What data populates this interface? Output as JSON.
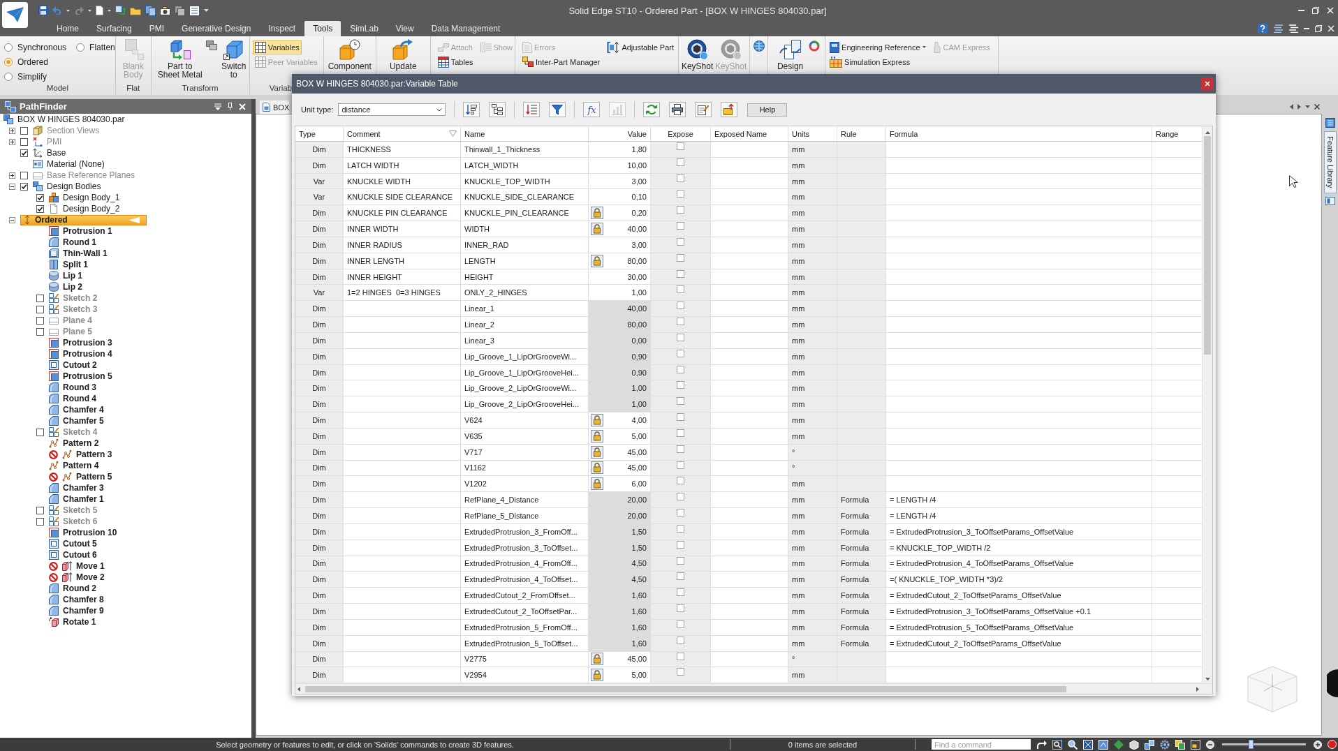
{
  "window": {
    "title": "Solid Edge ST10 - Ordered Part - [BOX W HINGES 804030.par]"
  },
  "ribbon": {
    "tabs": [
      {
        "label": "Home",
        "selected": false
      },
      {
        "label": "Surfacing",
        "selected": false
      },
      {
        "label": "PMI",
        "selected": false
      },
      {
        "label": "Generative Design",
        "selected": false
      },
      {
        "label": "Inspect",
        "selected": false
      },
      {
        "label": "Tools",
        "selected": true
      },
      {
        "label": "SimLab",
        "selected": false
      },
      {
        "label": "View",
        "selected": false
      },
      {
        "label": "Data Management",
        "selected": false
      }
    ],
    "groups": [
      {
        "label": "Model",
        "items": [
          {
            "kind": "radio",
            "label": "Synchronous",
            "selected": false
          },
          {
            "kind": "radio",
            "label": "Flatten",
            "selected": false
          },
          {
            "kind": "radio",
            "label": "Ordered",
            "selected": true
          },
          {
            "kind": "radio",
            "label": "Simplify",
            "selected": false
          }
        ]
      },
      {
        "label": "Flat",
        "items": [
          {
            "kind": "large",
            "label": "Blank Body",
            "disabled": true
          }
        ]
      },
      {
        "label": "Transform",
        "items": [
          {
            "kind": "large",
            "label": "Part to Sheet Metal",
            "disabled": false
          },
          {
            "kind": "icon",
            "disabled": false
          },
          {
            "kind": "large",
            "label": "Switch to",
            "disabled": false
          }
        ]
      },
      {
        "label": "Variab",
        "items": [
          {
            "kind": "small",
            "label": "Variables",
            "disabled": false,
            "on": true
          },
          {
            "kind": "small",
            "label": "Peer Variables",
            "disabled": true,
            "on": false
          }
        ]
      },
      {
        "items": [
          {
            "kind": "large",
            "label": "Component",
            "disabled": false
          }
        ]
      },
      {
        "items": [
          {
            "kind": "large",
            "label": "Update",
            "disabled": false
          }
        ]
      },
      {
        "items": [
          {
            "kind": "small",
            "label": "Attach",
            "disabled": true
          },
          {
            "kind": "small",
            "label": "Show",
            "disabled": true
          },
          {
            "kind": "small",
            "label": "Tables",
            "disabled": false
          }
        ]
      },
      {
        "items": [
          {
            "kind": "small",
            "label": "Errors",
            "disabled": true
          },
          {
            "kind": "small",
            "label": "Adjustable Part",
            "disabled": false
          },
          {
            "kind": "small",
            "label": "Inter-Part Manager",
            "disabled": false
          }
        ]
      },
      {
        "items": [
          {
            "kind": "large",
            "label": "KeyShot",
            "disabled": false
          },
          {
            "kind": "large",
            "label": "KeyShot",
            "disabled": true
          }
        ]
      },
      {
        "items": [
          {
            "kind": "icon",
            "disabled": false
          }
        ]
      },
      {
        "items": [
          {
            "kind": "large",
            "label": "Design",
            "disabled": false
          },
          {
            "kind": "icon",
            "disabled": false
          }
        ]
      },
      {
        "items": [
          {
            "kind": "small",
            "label": "Engineering Reference",
            "disabled": false,
            "dropdown": true
          },
          {
            "kind": "small",
            "label": "CAM Express",
            "disabled": true,
            "dropdown": false
          },
          {
            "kind": "small",
            "label": "Simulation Express",
            "disabled": false,
            "dropdown": false
          }
        ]
      }
    ]
  },
  "pathfinder": {
    "title": "PathFinder",
    "tree": [
      {
        "label": "BOX W HINGES 804030.par",
        "kind": "part",
        "selected": false,
        "children": [
          {
            "label": "Section Views",
            "kind": "section-views",
            "expanded": false,
            "checked": false,
            "selected": false
          },
          {
            "label": "PMI",
            "kind": "pmi",
            "expanded": false,
            "checked": false,
            "selected": false
          },
          {
            "label": "Base",
            "kind": "base",
            "checked": true,
            "selected": false
          },
          {
            "label": "Material (None)",
            "kind": "material",
            "selected": false
          },
          {
            "label": "Base Reference Planes",
            "kind": "reference-planes",
            "expanded": false,
            "checked": false,
            "selected": false
          },
          {
            "label": "Design Bodies",
            "kind": "design-bodies",
            "expanded": true,
            "checked": true,
            "selected": false,
            "children": [
              {
                "label": "Design Body_1",
                "kind": "body",
                "checked": true,
                "selected": false
              },
              {
                "label": "Design Body_2",
                "kind": "empty-body",
                "checked": true,
                "selected": false
              }
            ]
          },
          {
            "label": "Ordered",
            "kind": "ordered",
            "expanded": true,
            "selected": true,
            "children": [
              {
                "label": "Protrusion 1",
                "kind": "protrusion",
                "selected": false,
                "suppressed": false
              },
              {
                "label": "Round 1",
                "kind": "round",
                "selected": false,
                "suppressed": false
              },
              {
                "label": "Thin-Wall 1",
                "kind": "thin-wall",
                "selected": false,
                "suppressed": false
              },
              {
                "label": "Split 1",
                "kind": "split",
                "selected": false,
                "suppressed": false
              },
              {
                "label": "Lip 1",
                "kind": "lip",
                "selected": false,
                "suppressed": false
              },
              {
                "label": "Lip 2",
                "kind": "lip",
                "selected": false,
                "suppressed": false
              },
              {
                "label": "Sketch 2",
                "kind": "sketch",
                "checked": false,
                "selected": false,
                "suppressed": false
              },
              {
                "label": "Sketch 3",
                "kind": "sketch",
                "checked": false,
                "selected": false,
                "suppressed": false
              },
              {
                "label": "Plane 4",
                "kind": "plane",
                "checked": false,
                "selected": false,
                "suppressed": false
              },
              {
                "label": "Plane 5",
                "kind": "plane",
                "checked": false,
                "selected": false,
                "suppressed": false
              },
              {
                "label": "Protrusion 3",
                "kind": "protrusion",
                "selected": false,
                "suppressed": false
              },
              {
                "label": "Protrusion 4",
                "kind": "protrusion",
                "selected": false,
                "suppressed": false
              },
              {
                "label": "Cutout 2",
                "kind": "cutout",
                "selected": false,
                "suppressed": false
              },
              {
                "label": "Protrusion 5",
                "kind": "protrusion",
                "selected": false,
                "suppressed": false
              },
              {
                "label": "Round 3",
                "kind": "round",
                "selected": false,
                "suppressed": false
              },
              {
                "label": "Round 4",
                "kind": "round",
                "selected": false,
                "suppressed": false
              },
              {
                "label": "Chamfer 4",
                "kind": "chamfer",
                "selected": false,
                "suppressed": false
              },
              {
                "label": "Chamfer 5",
                "kind": "chamfer",
                "selected": false,
                "suppressed": false
              },
              {
                "label": "Sketch 4",
                "kind": "sketch",
                "checked": false,
                "selected": false,
                "suppressed": false
              },
              {
                "label": "Pattern 2",
                "kind": "pattern",
                "selected": false,
                "suppressed": false
              },
              {
                "label": "Pattern 3",
                "kind": "pattern",
                "selected": false,
                "suppressed": true
              },
              {
                "label": "Pattern 4",
                "kind": "pattern",
                "selected": false,
                "suppressed": false
              },
              {
                "label": "Pattern 5",
                "kind": "pattern",
                "selected": false,
                "suppressed": true
              },
              {
                "label": "Chamfer 3",
                "kind": "chamfer",
                "selected": false,
                "suppressed": false
              },
              {
                "label": "Chamfer 1",
                "kind": "chamfer",
                "selected": false,
                "suppressed": false
              },
              {
                "label": "Sketch 5",
                "kind": "sketch",
                "checked": false,
                "selected": false,
                "suppressed": false
              },
              {
                "label": "Sketch 6",
                "kind": "sketch",
                "checked": false,
                "selected": false,
                "suppressed": false
              },
              {
                "label": "Protrusion 10",
                "kind": "protrusion",
                "selected": false,
                "suppressed": false
              },
              {
                "label": "Cutout 5",
                "kind": "cutout",
                "selected": false,
                "suppressed": false
              },
              {
                "label": "Cutout 6",
                "kind": "cutout",
                "selected": false,
                "suppressed": false
              },
              {
                "label": "Move 1",
                "kind": "move",
                "selected": false,
                "suppressed": true
              },
              {
                "label": "Move 2",
                "kind": "move",
                "selected": false,
                "suppressed": true
              },
              {
                "label": "Round 2",
                "kind": "round",
                "selected": false,
                "suppressed": false
              },
              {
                "label": "Chamfer 8",
                "kind": "chamfer",
                "selected": false,
                "suppressed": false
              },
              {
                "label": "Chamfer 9",
                "kind": "chamfer",
                "selected": false,
                "suppressed": false
              },
              {
                "label": "Rotate 1",
                "kind": "rotate",
                "selected": false,
                "suppressed": false
              }
            ]
          }
        ]
      }
    ]
  },
  "document": {
    "tab": "BOX",
    "side_tab": "Feature Library"
  },
  "variable_table": {
    "title": "BOX W HINGES 804030.par:Variable Table",
    "unit_type_label": "Unit type:",
    "unit_type": "distance",
    "toolbar": [
      {
        "disabled": false
      },
      {
        "disabled": false
      },
      {
        "disabled": false
      },
      {
        "disabled": false
      },
      {
        "label": "fx",
        "disabled": false
      },
      {
        "disabled": true
      },
      {
        "disabled": false
      },
      {
        "disabled": false
      },
      {
        "disabled": false
      },
      {
        "disabled": false
      }
    ],
    "help_button": "Help",
    "columns": [
      "Type",
      "Comment",
      "Name",
      "Value",
      "Expose",
      "Exposed Name",
      "Units",
      "Rule",
      "Formula",
      "Range"
    ],
    "rows": [
      {
        "type": "Dim",
        "comment": "THICKNESS",
        "name": "Thinwall_1_Thickness",
        "locked": false,
        "value": "1,80",
        "read_only": false,
        "expose": false,
        "units": "mm"
      },
      {
        "type": "Dim",
        "comment": "LATCH WIDTH",
        "name": "LATCH_WIDTH",
        "locked": false,
        "value": "10,00",
        "read_only": false,
        "expose": false,
        "units": "mm"
      },
      {
        "type": "Var",
        "comment": "KNUCKLE WIDTH",
        "name": "KNUCKLE_TOP_WIDTH",
        "locked": false,
        "value": "3,00",
        "read_only": false,
        "expose": false,
        "units": "mm"
      },
      {
        "type": "Var",
        "comment": "KNUCKLE SIDE CLEARANCE",
        "name": "KNUCKLE_SIDE_CLEARANCE",
        "locked": false,
        "value": "0,10",
        "read_only": false,
        "expose": false,
        "units": "mm"
      },
      {
        "type": "Dim",
        "comment": "KNUCKLE PIN CLEARANCE",
        "name": "KNUCKLE_PIN_CLEARANCE",
        "locked": true,
        "value": "0,20",
        "read_only": false,
        "expose": false,
        "units": "mm"
      },
      {
        "type": "Dim",
        "comment": "INNER WIDTH",
        "name": "WIDTH",
        "locked": true,
        "value": "40,00",
        "read_only": false,
        "expose": false,
        "units": "mm"
      },
      {
        "type": "Dim",
        "comment": "INNER RADIUS",
        "name": "INNER_RAD",
        "locked": false,
        "value": "3,00",
        "read_only": false,
        "expose": false,
        "units": "mm"
      },
      {
        "type": "Dim",
        "comment": "INNER LENGTH",
        "name": "LENGTH",
        "locked": true,
        "value": "80,00",
        "read_only": false,
        "expose": false,
        "units": "mm"
      },
      {
        "type": "Dim",
        "comment": "INNER HEIGHT",
        "name": "HEIGHT",
        "locked": false,
        "value": "30,00",
        "read_only": false,
        "expose": false,
        "units": "mm"
      },
      {
        "type": "Var",
        "comment": "1=2 HINGES  0=3 HINGES",
        "name": "ONLY_2_HINGES",
        "locked": false,
        "value": "1,00",
        "read_only": false,
        "expose": false,
        "units": "mm"
      },
      {
        "type": "Dim",
        "name": "Linear_1",
        "locked": false,
        "value": "40,00",
        "read_only": true,
        "expose": false,
        "units": "mm"
      },
      {
        "type": "Dim",
        "name": "Linear_2",
        "locked": false,
        "value": "80,00",
        "read_only": true,
        "expose": false,
        "units": "mm"
      },
      {
        "type": "Dim",
        "name": "Linear_3",
        "locked": false,
        "value": "0,00",
        "read_only": true,
        "expose": false,
        "units": "mm"
      },
      {
        "type": "Dim",
        "name": "Lip_Groove_1_LipOrGrooveWi...",
        "locked": false,
        "value": "0,90",
        "read_only": true,
        "expose": false,
        "units": "mm"
      },
      {
        "type": "Dim",
        "name": "Lip_Groove_1_LipOrGrooveHei...",
        "locked": false,
        "value": "0,90",
        "read_only": true,
        "expose": false,
        "units": "mm"
      },
      {
        "type": "Dim",
        "name": "Lip_Groove_2_LipOrGrooveWi...",
        "locked": false,
        "value": "1,00",
        "read_only": true,
        "expose": false,
        "units": "mm"
      },
      {
        "type": "Dim",
        "name": "Lip_Groove_2_LipOrGrooveHei...",
        "locked": false,
        "value": "1,00",
        "read_only": true,
        "expose": false,
        "units": "mm"
      },
      {
        "type": "Dim",
        "name": "V624",
        "locked": true,
        "value": "4,00",
        "read_only": false,
        "expose": false,
        "units": "mm"
      },
      {
        "type": "Dim",
        "name": "V635",
        "locked": true,
        "value": "5,00",
        "read_only": false,
        "expose": false,
        "units": "mm"
      },
      {
        "type": "Dim",
        "name": "V717",
        "locked": true,
        "value": "45,00",
        "read_only": false,
        "expose": false,
        "units": "°"
      },
      {
        "type": "Dim",
        "name": "V1162",
        "locked": true,
        "value": "45,00",
        "read_only": false,
        "expose": false,
        "units": "°"
      },
      {
        "type": "Dim",
        "name": "V1202",
        "locked": true,
        "value": "6,00",
        "read_only": false,
        "expose": false,
        "units": "mm"
      },
      {
        "type": "Dim",
        "name": "RefPlane_4_Distance",
        "locked": false,
        "value": "20,00",
        "read_only": true,
        "expose": false,
        "units": "mm",
        "rule": "Formula",
        "formula": "= LENGTH /4"
      },
      {
        "type": "Dim",
        "name": "RefPlane_5_Distance",
        "locked": false,
        "value": "20,00",
        "read_only": true,
        "expose": false,
        "units": "mm",
        "rule": "Formula",
        "formula": "= LENGTH /4"
      },
      {
        "type": "Dim",
        "name": "ExtrudedProtrusion_3_FromOff...",
        "locked": false,
        "value": "1,50",
        "read_only": true,
        "expose": false,
        "units": "mm",
        "rule": "Formula",
        "formula": "= ExtrudedProtrusion_3_ToOffsetParams_OffsetValue"
      },
      {
        "type": "Dim",
        "name": "ExtrudedProtrusion_3_ToOffset...",
        "locked": false,
        "value": "1,50",
        "read_only": true,
        "expose": false,
        "units": "mm",
        "rule": "Formula",
        "formula": "= KNUCKLE_TOP_WIDTH /2"
      },
      {
        "type": "Dim",
        "name": "ExtrudedProtrusion_4_FromOff...",
        "locked": false,
        "value": "4,50",
        "read_only": true,
        "expose": false,
        "units": "mm",
        "rule": "Formula",
        "formula": "= ExtrudedProtrusion_4_ToOffsetParams_OffsetValue"
      },
      {
        "type": "Dim",
        "name": "ExtrudedProtrusion_4_ToOffset...",
        "locked": false,
        "value": "4,50",
        "read_only": true,
        "expose": false,
        "units": "mm",
        "rule": "Formula",
        "formula": "=( KNUCKLE_TOP_WIDTH *3)/2"
      },
      {
        "type": "Dim",
        "name": "ExtrudedCutout_2_FromOffset...",
        "locked": false,
        "value": "1,60",
        "read_only": true,
        "expose": false,
        "units": "mm",
        "rule": "Formula",
        "formula": "= ExtrudedCutout_2_ToOffsetParams_OffsetValue"
      },
      {
        "type": "Dim",
        "name": "ExtrudedCutout_2_ToOffsetPar...",
        "locked": false,
        "value": "1,60",
        "read_only": true,
        "expose": false,
        "units": "mm",
        "rule": "Formula",
        "formula": "= ExtrudedProtrusion_3_ToOffsetParams_OffsetValue +0.1"
      },
      {
        "type": "Dim",
        "name": "ExtrudedProtrusion_5_FromOff...",
        "locked": false,
        "value": "1,60",
        "read_only": true,
        "expose": false,
        "units": "mm",
        "rule": "Formula",
        "formula": "= ExtrudedProtrusion_5_ToOffsetParams_OffsetValue"
      },
      {
        "type": "Dim",
        "name": "ExtrudedProtrusion_5_ToOffset...",
        "locked": false,
        "value": "1,60",
        "read_only": true,
        "expose": false,
        "units": "mm",
        "rule": "Formula",
        "formula": "= ExtrudedCutout_2_ToOffsetParams_OffsetValue"
      },
      {
        "type": "Dim",
        "name": "V2775",
        "locked": true,
        "value": "45,00",
        "read_only": false,
        "expose": false,
        "units": "°"
      },
      {
        "type": "Dim",
        "name": "V2954",
        "locked": true,
        "value": "5,00",
        "read_only": false,
        "expose": false,
        "units": "mm"
      }
    ]
  },
  "status_bar": {
    "message": "Select geometry or features to edit, or click on 'Solids' commands to create 3D features.",
    "selection": "0 items are selected",
    "command_search": {
      "placeholder": "Find a command"
    },
    "zoom_slider": {
      "level": 0.34
    }
  }
}
